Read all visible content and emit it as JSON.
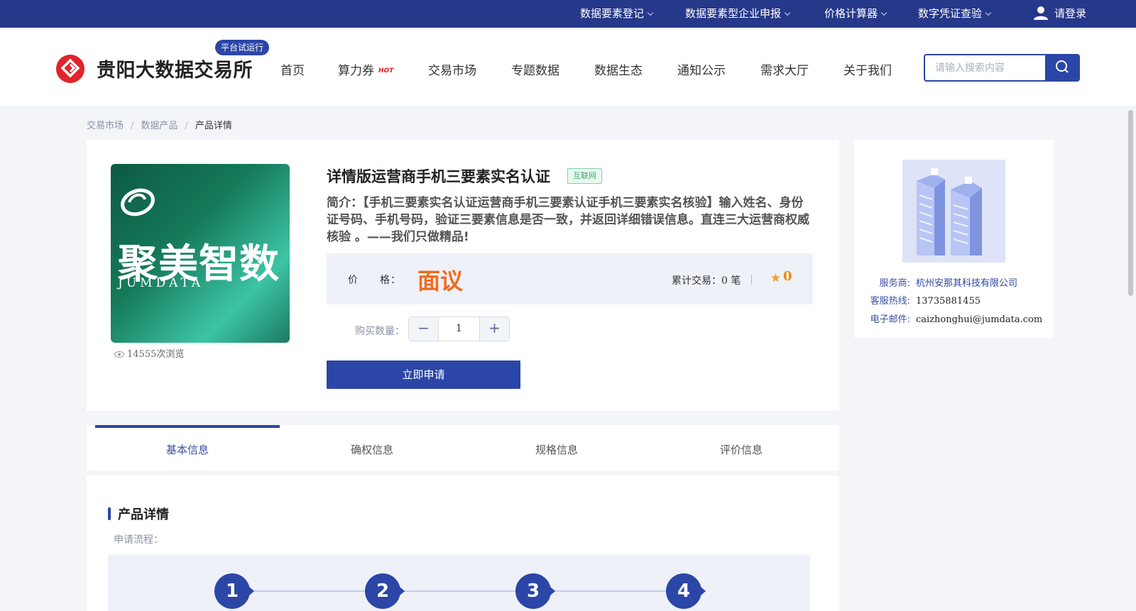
{
  "topbar": {
    "items": [
      {
        "label": "数据要素登记"
      },
      {
        "label": "数据要素型企业申报"
      },
      {
        "label": "价格计算器"
      },
      {
        "label": "数字凭证查验"
      }
    ],
    "login_label": "请登录"
  },
  "header": {
    "logo_text": "贵阳大数据交易所",
    "trial_badge": "平台试运行",
    "nav": [
      "首页",
      "算力券",
      "交易市场",
      "专题数据",
      "数据生态",
      "通知公示",
      "需求大厅",
      "关于我们"
    ],
    "hot_tag": "HOT",
    "search_placeholder": "请输入搜索内容"
  },
  "breadcrumb": [
    "交易市场",
    "数据产品",
    "产品详情"
  ],
  "product": {
    "image_brand_cn": "聚美智数",
    "image_brand_en": "JUMDATA",
    "views": "14555次浏览",
    "title": "详情版运营商手机三要素实名认证",
    "tag": "互联网",
    "description": "简介：【手机三要素实名认证运营商手机三要素认证手机三要素实名核验】输入姓名、身份证号码、手机号码，验证三要素信息是否一致，并返回详细错误信息。直连三大运营商权威核验 。——我们只做精品!",
    "price_label": "价　　格：",
    "price_value": "面议",
    "cumulative_trade": "累计交易：0 笔",
    "star_count": "0",
    "qty_label": "购买数量：",
    "qty_minus": "−",
    "qty_value": "1",
    "qty_plus": "+",
    "apply_label": "立即申请"
  },
  "provider": {
    "service_label": "服务商:",
    "service_value": "杭州安那其科技有限公司",
    "hotline_label": "客服热线:",
    "hotline_value": "13735881455",
    "email_label": "电子邮件:",
    "email_value": "caizhonghui@jumdata.com"
  },
  "tabs": [
    {
      "label": "基本信息",
      "active": true
    },
    {
      "label": "确权信息",
      "active": false
    },
    {
      "label": "规格信息",
      "active": false
    },
    {
      "label": "评价信息",
      "active": false
    }
  ],
  "detail": {
    "title": "产品详情",
    "flow_label": "申请流程：",
    "steps": [
      "1",
      "2",
      "3",
      "4"
    ]
  },
  "colors": {
    "primary": "#2b46a6",
    "topbar": "#26388a",
    "price": "#f26b1d",
    "tag_green": "#3aab73"
  }
}
